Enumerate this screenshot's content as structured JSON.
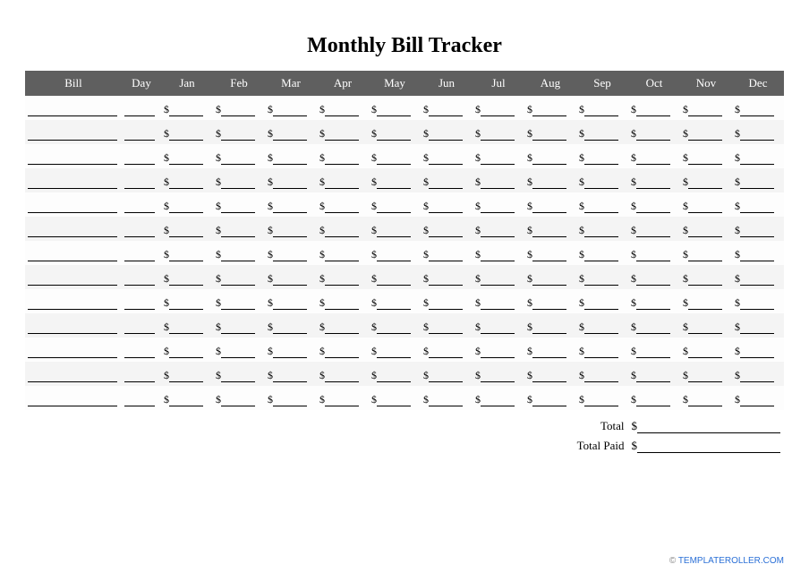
{
  "title": "Monthly Bill Tracker",
  "columns": [
    "Bill",
    "Day",
    "Jan",
    "Feb",
    "Mar",
    "Apr",
    "May",
    "Jun",
    "Jul",
    "Aug",
    "Sep",
    "Oct",
    "Nov",
    "Dec"
  ],
  "currency_symbol": "$",
  "row_count": 13,
  "totals": {
    "total_label": "Total",
    "total_paid_label": "Total Paid"
  },
  "footer": {
    "copyright": "©",
    "site": "TEMPLATEROLLER.COM"
  }
}
